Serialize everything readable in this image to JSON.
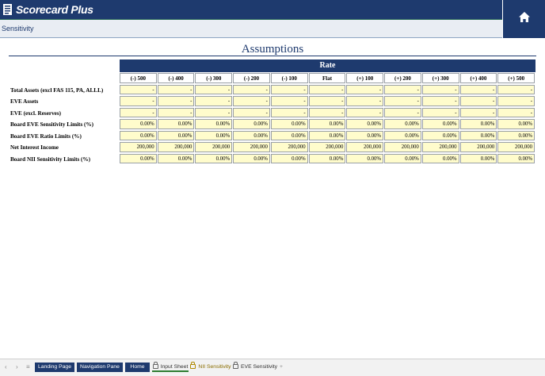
{
  "app": {
    "name": "Scorecard Plus",
    "section": "Sensitivity"
  },
  "page": {
    "title": "Assumptions"
  },
  "table": {
    "header": "Rate",
    "columns": [
      "(-) 500",
      "(-) 400",
      "(-) 300",
      "(-) 200",
      "(-) 100",
      "Flat",
      "(+) 100",
      "(+) 200",
      "(+) 300",
      "(+) 400",
      "(+) 500"
    ],
    "rows": [
      {
        "label": "Total Assets (excl FAS 115, PA, ALLL)",
        "values": [
          "-",
          "-",
          "-",
          "-",
          "-",
          "-",
          "-",
          "-",
          "-",
          "-",
          "-"
        ]
      },
      {
        "label": "EVE Assets",
        "values": [
          "-",
          "-",
          "-",
          "-",
          "-",
          "-",
          "-",
          "-",
          "-",
          "-",
          "-"
        ]
      },
      {
        "label": "EVE (excl. Reserves)",
        "values": [
          "-",
          "-",
          "-",
          "-",
          "-",
          "-",
          "-",
          "-",
          "-",
          "-",
          "-"
        ]
      },
      {
        "label": "Board EVE Sensitivity Limits (%)",
        "values": [
          "0.00%",
          "0.00%",
          "0.00%",
          "0.00%",
          "0.00%",
          "0.00%",
          "0.00%",
          "0.00%",
          "0.00%",
          "0.00%",
          "0.00%"
        ]
      },
      {
        "label": "Board EVE Ratio Limits (%)",
        "values": [
          "0.00%",
          "0.00%",
          "0.00%",
          "0.00%",
          "0.00%",
          "0.00%",
          "0.00%",
          "0.00%",
          "0.00%",
          "0.00%",
          "0.00%"
        ]
      },
      {
        "label": "Net Interest Income",
        "values": [
          "200,000",
          "200,000",
          "200,000",
          "200,000",
          "200,000",
          "200,000",
          "200,000",
          "200,000",
          "200,000",
          "200,000",
          "200,000"
        ]
      },
      {
        "label": "Board NII Sensitivity Limits (%)",
        "values": [
          "0.00%",
          "0.00%",
          "0.00%",
          "0.00%",
          "0.00%",
          "0.00%",
          "0.00%",
          "0.00%",
          "0.00%",
          "0.00%",
          "0.00%"
        ]
      }
    ]
  },
  "tabs": {
    "landing": "Landing Page",
    "navigation": "Navigation Pane",
    "home": "Home",
    "input": "Input Sheet",
    "nii": "NII Sensitivity",
    "eve": "EVE Sensitivity",
    "add": "+"
  },
  "icons": {
    "home": "home-icon",
    "logo": "scorecard-logo-icon"
  },
  "colors": {
    "brand": "#1e3a6e",
    "input_cell": "#fffccc",
    "active_tab": "#2e7d32"
  }
}
